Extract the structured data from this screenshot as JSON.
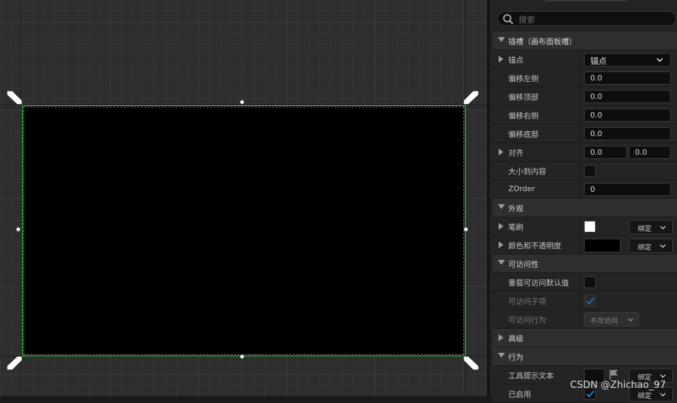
{
  "search": {
    "placeholder": "搜索"
  },
  "categories": {
    "slot": "插槽（画布面板槽）",
    "appearance": "外观",
    "accessibility": "可访问性",
    "advanced": "高级",
    "behavior": "行为"
  },
  "slot": {
    "anchors": {
      "label": "锚点",
      "value": "锚点"
    },
    "offset_left": {
      "label": "偏移左侧",
      "value": "0.0"
    },
    "offset_top": {
      "label": "偏移顶部",
      "value": "0.0"
    },
    "offset_right": {
      "label": "偏移右侧",
      "value": "0.0"
    },
    "offset_bottom": {
      "label": "偏移底部",
      "value": "0.0"
    },
    "alignment": {
      "label": "对齐",
      "x": "0.0",
      "y": "0.0"
    },
    "size_to_content": {
      "label": "大小到内容",
      "checked": false
    },
    "zorder": {
      "label": "ZOrder",
      "value": "0"
    }
  },
  "appearance": {
    "brush": {
      "label": "笔刷",
      "bind": "绑定",
      "swatch_color": "#ffffff"
    },
    "color_opacity": {
      "label": "颜色和不透明度",
      "bind": "绑定",
      "color": "#000000"
    }
  },
  "accessibility": {
    "override_default": {
      "label": "重载可访问默认值",
      "checked": false
    },
    "accessible_children": {
      "label": "可访问子项",
      "checked": true
    },
    "accessible_behavior": {
      "label": "可访问行为",
      "value": "不可访问"
    }
  },
  "behavior": {
    "tooltip_text": {
      "label": "工具提示文本",
      "bind": "绑定"
    },
    "enabled": {
      "label": "已启用",
      "bind": "绑定",
      "checked": true
    }
  },
  "watermark": "CSDN @Zhichao_97",
  "colors": {
    "selection_outline": "#2ee82e",
    "checkmark": "#2f7fd6"
  }
}
